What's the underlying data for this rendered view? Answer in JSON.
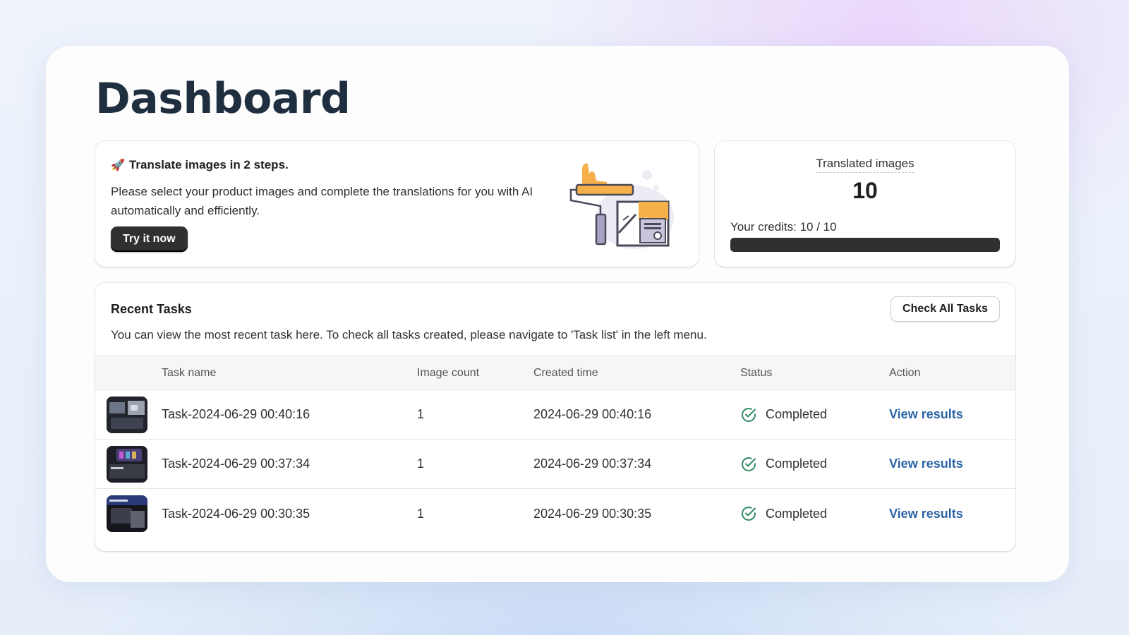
{
  "page": {
    "title": "Dashboard"
  },
  "promo": {
    "icon": "rocket-icon",
    "title": "Translate images in 2 steps.",
    "description": "Please select your product images and complete the translations for you with AI automatically and efficiently.",
    "button_label": "Try it now"
  },
  "stats": {
    "label": "Translated images",
    "value": "10",
    "credits_text": "Your credits: 10 / 10",
    "credits_used_fraction": 1.0
  },
  "recent_tasks": {
    "title": "Recent Tasks",
    "description": "You can view the most recent task here. To check all tasks created, please navigate to 'Task list' in the left menu.",
    "button_label": "Check All Tasks",
    "columns": [
      "Task name",
      "Image count",
      "Created time",
      "Status",
      "Action"
    ],
    "rows": [
      {
        "name": "Task-2024-06-29 00:40:16",
        "count": "1",
        "created": "2024-06-29 00:40:16",
        "status": "Completed",
        "action": "View results"
      },
      {
        "name": "Task-2024-06-29 00:37:34",
        "count": "1",
        "created": "2024-06-29 00:37:34",
        "status": "Completed",
        "action": "View results"
      },
      {
        "name": "Task-2024-06-29 00:30:35",
        "count": "1",
        "created": "2024-06-29 00:30:35",
        "status": "Completed",
        "action": "View results"
      }
    ]
  },
  "colors": {
    "primary_dark": "#303030",
    "link": "#2b63a6",
    "success": "#2e8a63",
    "illustration_accent": "#f5b04a"
  }
}
